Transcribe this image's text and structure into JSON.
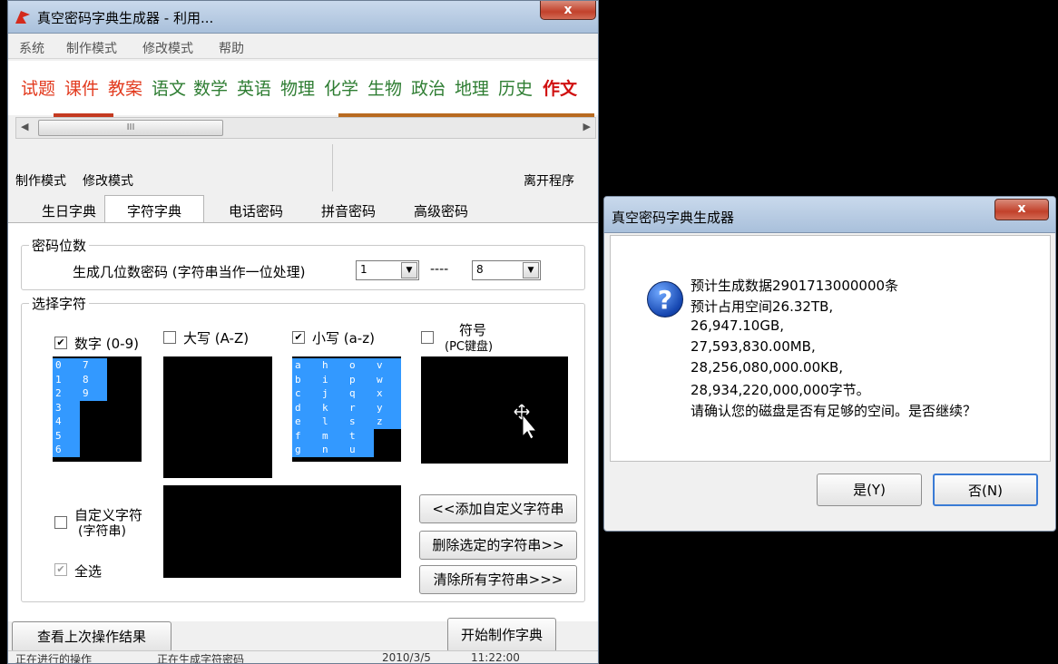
{
  "main_window": {
    "title": "真空密码字典生成器 - 利用...",
    "menu": [
      "系统",
      "制作模式",
      "修改模式",
      "帮助"
    ],
    "subjects": [
      {
        "label": "试题",
        "color": "#e23a1e"
      },
      {
        "label": "课件",
        "color": "#e23a1e"
      },
      {
        "label": "教案",
        "color": "#e23a1e"
      },
      {
        "label": "语文",
        "color": "#2e7d32"
      },
      {
        "label": "数学",
        "color": "#2e7d32"
      },
      {
        "label": "英语",
        "color": "#2e7d32"
      },
      {
        "label": "物理",
        "color": "#2e7d32"
      },
      {
        "label": "化学",
        "color": "#2e7d32"
      },
      {
        "label": "生物",
        "color": "#2e7d32"
      },
      {
        "label": "政治",
        "color": "#2e7d32"
      },
      {
        "label": "地理",
        "color": "#2e7d32"
      },
      {
        "label": "历史",
        "color": "#2e7d32"
      },
      {
        "label": "作文",
        "color": "#d01010"
      }
    ],
    "scroll_thumb_glyph": "III",
    "mode_label_1": "制作模式",
    "mode_label_2": "修改模式",
    "exit_label": "离开程序",
    "tabs": [
      "生日字典",
      "字符字典",
      "电话密码",
      "拼音密码",
      "高级密码"
    ],
    "active_tab": "字符字典",
    "password_length": {
      "legend": "密码位数",
      "label": "生成几位数密码 (字符串当作一位处理)",
      "min": "1",
      "separator": "----",
      "max": "8"
    },
    "charset": {
      "legend": "选择字符",
      "digits_label": "数字 (0-9)",
      "digits_checked": true,
      "upper_label": "大写 (A-Z)",
      "upper_checked": false,
      "lower_label": "小写 (a-z)",
      "lower_checked": true,
      "symbol_label_1": "符号",
      "symbol_label_2": "(PC键盘)",
      "symbol_checked": false,
      "digits_columns": [
        [
          "0",
          "1",
          "2",
          "3",
          "4",
          "5",
          "6"
        ],
        [
          "7",
          "8",
          "9"
        ]
      ],
      "lower_columns": [
        [
          "a",
          "b",
          "c",
          "d",
          "e",
          "f",
          "g"
        ],
        [
          "h",
          "i",
          "j",
          "k",
          "l",
          "m",
          "n"
        ],
        [
          "o",
          "p",
          "q",
          "r",
          "s",
          "t",
          "u"
        ],
        [
          "v",
          "w",
          "x",
          "y",
          "z"
        ]
      ],
      "custom_label_1": "自定义字符",
      "custom_label_2": "(字符串)",
      "custom_checked": false,
      "select_all_label": "全选",
      "select_all_checked": true,
      "add_button": "<<添加自定义字符串",
      "delete_button": "删除选定的字符串>>",
      "clear_button": "清除所有字符串>>>"
    },
    "view_last_button": "查看上次操作结果",
    "start_button": "开始制作字典",
    "status": [
      "正在进行的操作",
      "正在生成字符密码",
      "2010/3/5",
      "11:22:00"
    ],
    "check_mark": "✔"
  },
  "dialog": {
    "title": "真空密码字典生成器",
    "icon": "?",
    "lines": [
      "预计生成数据2901713000000条",
      "预计占用空间26.32TB,",
      "26,947.10GB,",
      "27,593,830.00MB,",
      "28,256,080,000.00KB,",
      "28,934,220,000,000字节。",
      "请确认您的磁盘是否有足够的空间。是否继续？"
    ],
    "yes_button": "是(Y)",
    "no_button": "否(N)",
    "close_glyph": "x"
  },
  "close_glyph": "x"
}
